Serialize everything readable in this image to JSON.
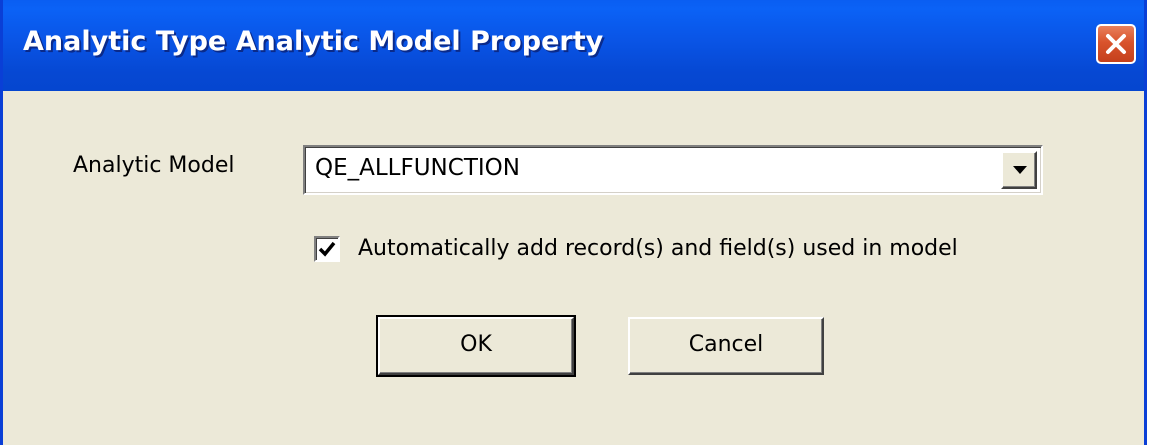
{
  "window": {
    "title": "Analytic Type Analytic Model Property"
  },
  "form": {
    "analytic_model_label": "Analytic Model",
    "analytic_model_value": "QE_ALLFUNCTION",
    "auto_add_label": "Automatically add record(s) and field(s) used in model",
    "auto_add_checked": true
  },
  "buttons": {
    "ok_label": "OK",
    "cancel_label": "Cancel"
  },
  "icons": {
    "close": "close-icon",
    "dropdown": "chevron-down-icon",
    "check": "checkmark-icon"
  },
  "colors": {
    "titlebar": "#0a56e8",
    "close_button": "#d9532c",
    "dialog_background": "#ece9d8"
  }
}
